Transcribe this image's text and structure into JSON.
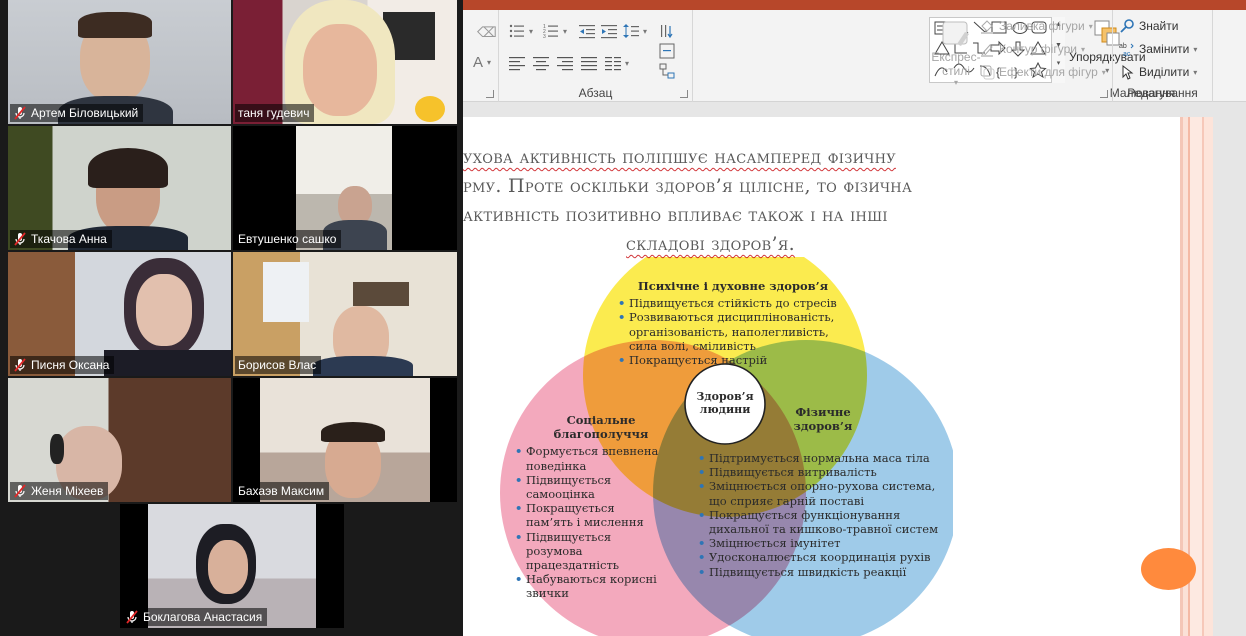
{
  "participants": [
    {
      "name": "Артем Біловицький",
      "muted": true
    },
    {
      "name": "таня гудевич",
      "muted": false
    },
    {
      "name": "Ткачова Анна",
      "muted": true
    },
    {
      "name": "Евтушенко сашко",
      "muted": false
    },
    {
      "name": "Писня Оксана",
      "muted": true
    },
    {
      "name": "Борисов Влас",
      "muted": false,
      "active": true
    },
    {
      "name": "Женя Міхеев",
      "muted": true
    },
    {
      "name": "Бахаэв Максим",
      "muted": false
    },
    {
      "name": "Боклагова Анастасия",
      "muted": true
    }
  ],
  "ribbon": {
    "paragraph_label": "Абзац",
    "drawing_label": "Малювання",
    "editing_label": "Редагування",
    "arrange": "Упорядкувати",
    "express_styles": "Експрес-стилі",
    "shape_fill": "Заливка фігури",
    "shape_outline": "Контур фігури",
    "shape_effects": "Ефекти для фігур",
    "find": "Знайти",
    "replace": "Замінити",
    "select": "Виділити",
    "font_color_letter": "A"
  },
  "slide": {
    "line1": "ухова активність поліпшує насамперед фізичну",
    "line2": "рму. Проте оскільки здоров’я цілісне, то фізична",
    "line3": "активність позитивно впливає також і на інші",
    "line4": "складові здоров’я."
  },
  "venn": {
    "center": "Здоров’я людини",
    "top_title": "Психічне і духовне здоров’я",
    "top_items": [
      "Підвищується стійкість до стресів",
      "Розвиваються дисциплінованість, організованість, наполегливість, сила волі, сміливість",
      "Покращується настрій"
    ],
    "left_title": "Соціальне благополуччя",
    "left_items": [
      "Формується впевнена поведінка",
      "Підвищується самооцінка",
      "Покращується пам’ять і мислення",
      "Підвищується розумова працездатність",
      "Набуваються корисні звички"
    ],
    "right_title": "Фізичне здоров’я",
    "right_items": [
      "Підтримується нормальна маса тіла",
      "Підвищується витривалість",
      "Зміцнюється опорно-рухова система, що сприяє гарній поставі",
      "Покращується функціонування дихальної та кишково-травної систем",
      "Зміцнюється імунітет",
      "Удосконалюється координація рухів",
      "Підвищується швидкість реакції"
    ],
    "colors": {
      "yellow": "#fbeb4f",
      "pink": "#f3a9bd",
      "blue": "#9fcbe9"
    }
  }
}
